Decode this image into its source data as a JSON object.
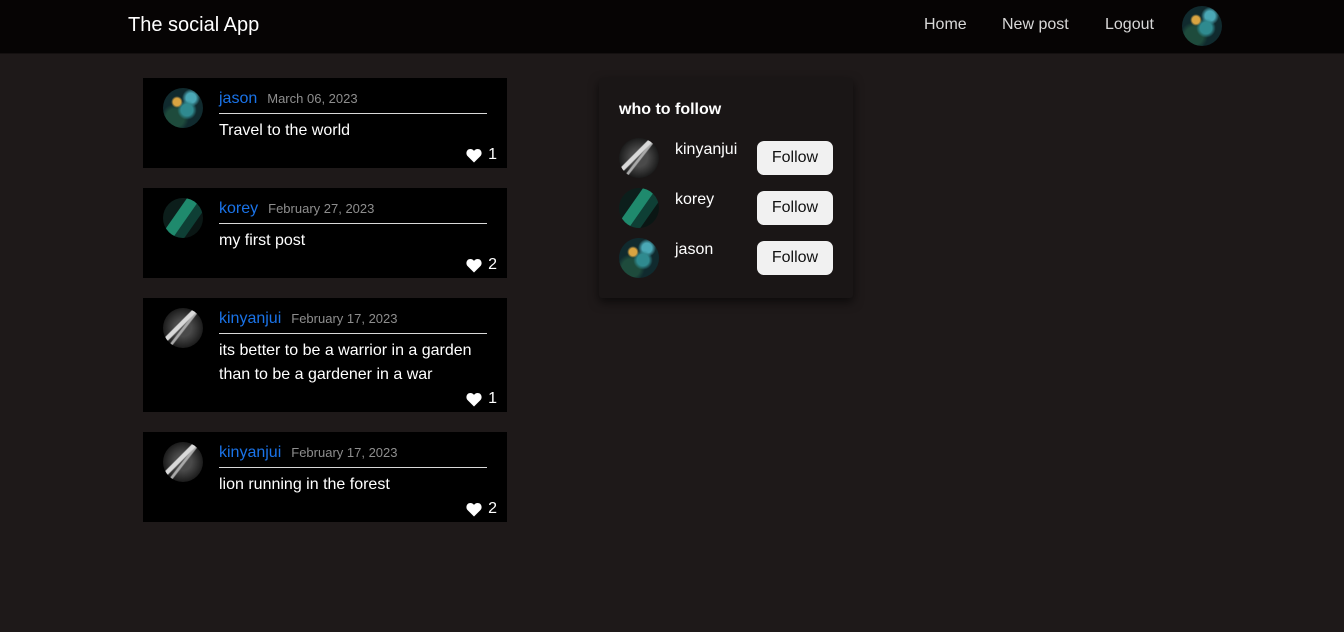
{
  "app": {
    "title": "The social App"
  },
  "nav": {
    "links": [
      "Home",
      "New post",
      "Logout"
    ]
  },
  "posts": [
    {
      "user": "jason",
      "date": "March 06, 2023",
      "content": "Travel to the world",
      "likes": "1"
    },
    {
      "user": "korey",
      "date": "February 27, 2023",
      "content": "my first post",
      "likes": "2"
    },
    {
      "user": "kinyanjui",
      "date": "February 17, 2023",
      "content": "its better to be a warrior in a garden than to be a gardener in a war",
      "likes": "1"
    },
    {
      "user": "kinyanjui",
      "date": "February 17, 2023",
      "content": "lion running in the forest",
      "likes": "2"
    }
  ],
  "who_to_follow": {
    "title": "who to follow",
    "users": [
      {
        "name": "kinyanjui",
        "button": "Follow"
      },
      {
        "name": "korey",
        "button": "Follow"
      },
      {
        "name": "jason",
        "button": "Follow"
      }
    ]
  },
  "colors": {
    "background": "#1e1919",
    "navbar": "#060404",
    "username_link": "#1a73e8",
    "post_card": "#000000",
    "follow_button": "#f1f1f1"
  },
  "icons": {
    "like": "heart-icon"
  }
}
